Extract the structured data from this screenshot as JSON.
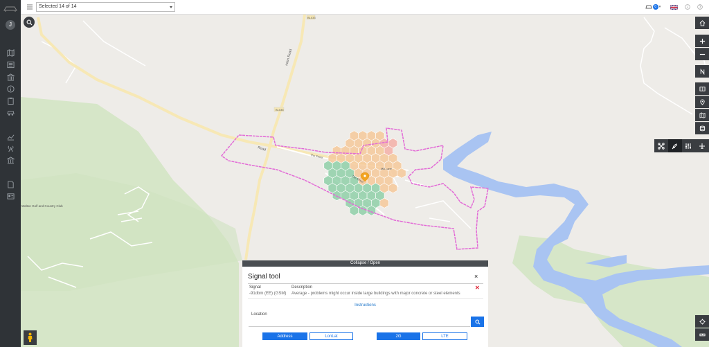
{
  "topbar": {
    "selector_value": "Selected 14 of 14",
    "notification_count": "0"
  },
  "user": {
    "initial": "J"
  },
  "map": {
    "labels": {
      "road_b": "B1033",
      "road_b2": "B1035",
      "road_main": "Road",
      "road_street": "The Street",
      "road_diagonal": "The Street",
      "road_mill": "Mill Lane",
      "road_vertical": "ndon Road",
      "golf": "Walton Golf and Country Club"
    },
    "colors": {
      "water": "#a9c4f2",
      "green": "#d6e6c8",
      "road": "#f7e8b5",
      "route": "#e26ad6",
      "hex_good": "#8fd0a8",
      "hex_avg": "#f4c99a",
      "hex_bad": "#f3b0a8",
      "marker": "#f2a320"
    }
  },
  "panel": {
    "collapse_label": "Collapse / Open",
    "title": "Signal tool",
    "close_label": "×",
    "signal_header": "Signal",
    "description_header": "Description",
    "signal_value": "-91dbm (EE) (GSM)",
    "description_value": "Average - problems might occur inside large buildings with major concrete or steel elements",
    "remove_label": "✕",
    "instructions_label": "Instructions",
    "location_label": "Location",
    "location_placeholder": "",
    "buttons": {
      "address": "Address",
      "lonlat": "LonLat",
      "g2": "2G",
      "lte": "LTE"
    }
  }
}
